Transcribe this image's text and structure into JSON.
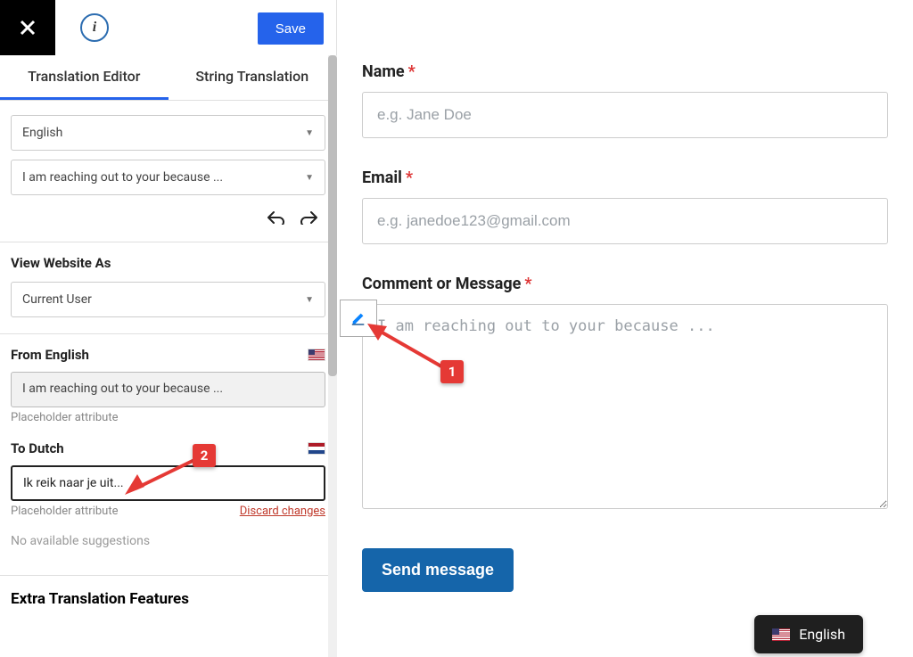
{
  "topbar": {
    "save_label": "Save",
    "info_glyph": "i"
  },
  "tabs": {
    "editor": "Translation Editor",
    "string": "String Translation"
  },
  "selectors": {
    "language": "English",
    "string_item": "I am reaching out to your because ..."
  },
  "view_as": {
    "heading": "View Website As",
    "value": "Current User"
  },
  "from": {
    "heading": "From English",
    "value": "I am reaching out to your because ...",
    "note": "Placeholder attribute"
  },
  "to": {
    "heading": "To Dutch",
    "value": "Ik reik naar je uit...",
    "note": "Placeholder attribute",
    "discard": "Discard changes"
  },
  "suggestions": {
    "none": "No available suggestions"
  },
  "extra": {
    "heading": "Extra Translation Features"
  },
  "form": {
    "name_label": "Name",
    "name_placeholder": "e.g. Jane Doe",
    "email_label": "Email",
    "email_placeholder": "e.g. janedoe123@gmail.com",
    "message_label": "Comment or Message",
    "message_placeholder": "I am reaching out to your because ...",
    "submit": "Send message"
  },
  "lang_switcher": {
    "label": "English"
  },
  "callouts": {
    "one": "1",
    "two": "2"
  }
}
